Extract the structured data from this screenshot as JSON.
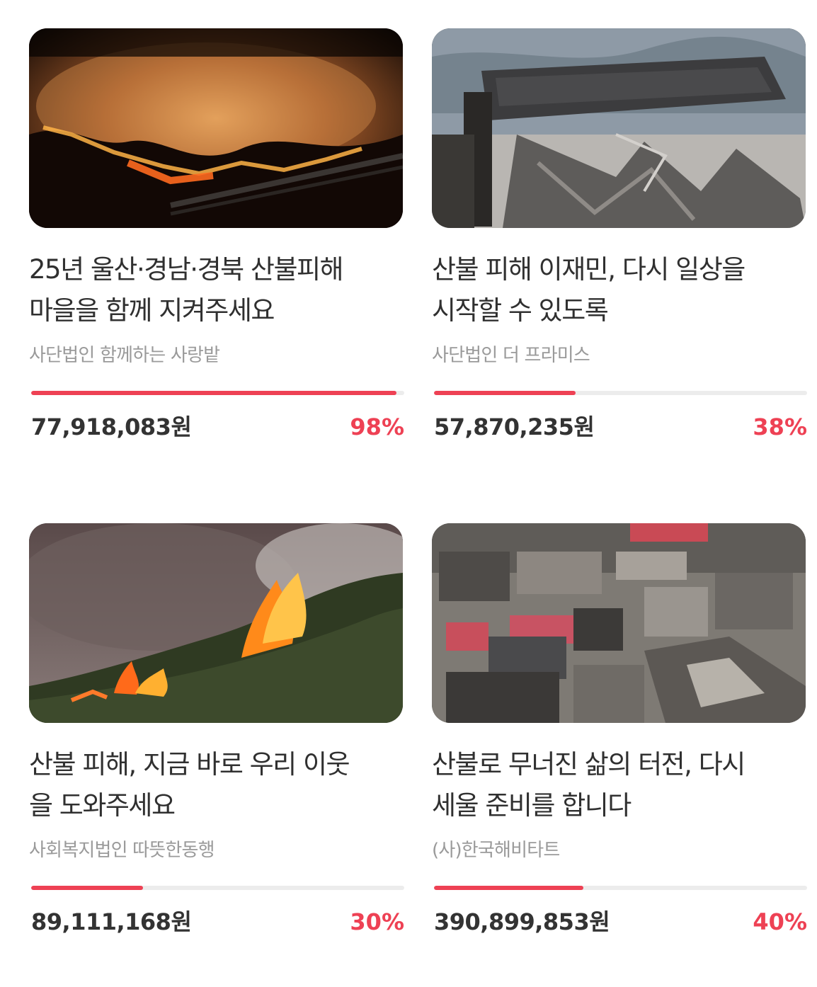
{
  "campaigns": [
    {
      "title_line1": "25년 울산·경남·경북 산불피해",
      "title_line2": "마을을 함께 지켜주세요",
      "organization": "사단법인 함께하는 사랑밭",
      "amount": "77,918,083원",
      "percent_label": "98%",
      "progress": 0.98
    },
    {
      "title_line1": "산불 피해 이재민, 다시 일상을",
      "title_line2": "시작할 수 있도록",
      "organization": "사단법인 더 프라미스",
      "amount": "57,870,235원",
      "percent_label": "38%",
      "progress": 0.38
    },
    {
      "title_line1": "산불 피해, 지금 바로 우리 이웃",
      "title_line2": "을 도와주세요",
      "organization": "사회복지법인 따뜻한동행",
      "amount": "89,111,168원",
      "percent_label": "30%",
      "progress": 0.3
    },
    {
      "title_line1": "산불로 무너진 삶의 터전, 다시",
      "title_line2": "세울 준비를 합니다",
      "organization": "(사)한국해비타트",
      "amount": "390,899,853원",
      "percent_label": "40%",
      "progress": 0.4
    }
  ],
  "colors": {
    "accent": "#ee4154",
    "track": "#ececec",
    "title": "#303030",
    "org": "#9a9a9a"
  }
}
